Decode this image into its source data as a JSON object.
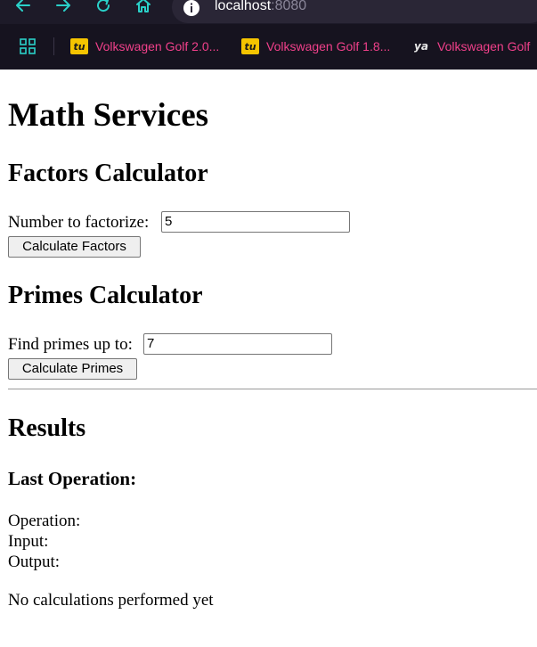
{
  "browser": {
    "url_host": "localhost",
    "url_port": ":8080",
    "icons": [
      "back-arrow-icon",
      "forward-arrow-icon",
      "reload-icon",
      "home-icon",
      "site-info-icon",
      "apps-grid-icon"
    ],
    "accent_color": "#2ad1c9",
    "bookmarks": [
      {
        "favicon": "tu",
        "label": "Volkswagen Golf 2.0..."
      },
      {
        "favicon": "tu",
        "label": "Volkswagen Golf 1.8..."
      },
      {
        "favicon": "ya",
        "label": "Volkswagen Golf"
      }
    ],
    "bookmark_color": "#f0408a"
  },
  "page": {
    "title": "Math Services",
    "factors": {
      "heading": "Factors Calculator",
      "label": "Number to factorize:",
      "value": "5",
      "button": "Calculate Factors"
    },
    "primes": {
      "heading": "Primes Calculator",
      "label": "Find primes up to:",
      "value": "7",
      "button": "Calculate Primes"
    },
    "results": {
      "heading": "Results",
      "subheading": "Last Operation:",
      "operation_label": "Operation:",
      "input_label": "Input:",
      "output_label": "Output:",
      "status": "No calculations performed yet"
    }
  }
}
